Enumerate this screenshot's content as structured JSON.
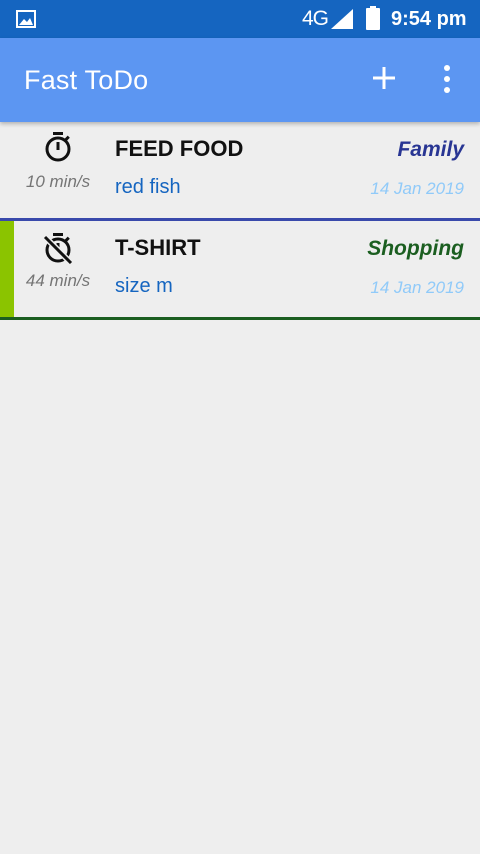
{
  "status_bar": {
    "network": "4G",
    "time": "9:54 pm",
    "icons": [
      "image-icon",
      "signal-icon",
      "battery-icon"
    ]
  },
  "app_bar": {
    "title": "Fast ToDo",
    "actions": [
      "add-icon",
      "more-vert-icon"
    ],
    "color": "#5c96f2"
  },
  "todos": [
    {
      "title": "FEED FOOD",
      "note": "red fish",
      "duration": "10 min/s",
      "category": "Family",
      "category_color": "#283593",
      "date": "14 Jan 2019",
      "timer_icon": "timer-icon",
      "divider_color": "#3949ab",
      "note_color": "#1565c0"
    },
    {
      "title": "T-SHIRT",
      "note": "size m",
      "duration": "44 min/s",
      "category": "Shopping",
      "category_color": "#1b5e20",
      "date": "14 Jan 2019",
      "timer_icon": "timer-off-icon",
      "divider_color": "#1b5e20",
      "accent_color": "#8bc400",
      "note_color": "#1565c0"
    }
  ]
}
